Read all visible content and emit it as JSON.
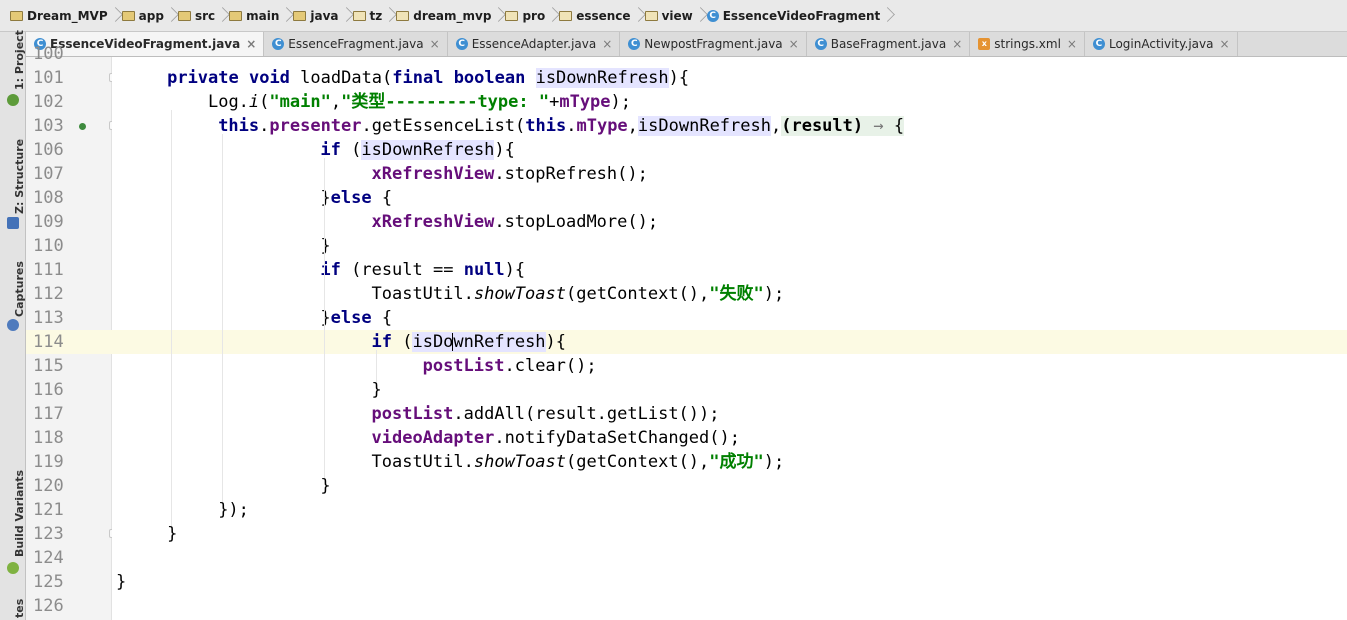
{
  "breadcrumb": {
    "items": [
      {
        "label": "Dream_MVP",
        "icon": "module-folder-icon"
      },
      {
        "label": "app",
        "icon": "module-folder-icon"
      },
      {
        "label": "src",
        "icon": "folder-icon"
      },
      {
        "label": "main",
        "icon": "folder-icon"
      },
      {
        "label": "java",
        "icon": "folder-icon"
      },
      {
        "label": "tz",
        "icon": "package-icon"
      },
      {
        "label": "dream_mvp",
        "icon": "package-icon"
      },
      {
        "label": "pro",
        "icon": "package-icon"
      },
      {
        "label": "essence",
        "icon": "package-icon"
      },
      {
        "label": "view",
        "icon": "package-icon"
      },
      {
        "label": "EssenceVideoFragment",
        "icon": "class-icon"
      }
    ]
  },
  "tabs": [
    {
      "label": "EssenceVideoFragment.java",
      "active": true,
      "close": "×"
    },
    {
      "label": "EssenceFragment.java",
      "close": "×"
    },
    {
      "label": "EssenceAdapter.java",
      "close": "×"
    },
    {
      "label": "NewpostFragment.java",
      "close": "×"
    },
    {
      "label": "BaseFragment.java",
      "close": "×"
    },
    {
      "label": "strings.xml",
      "close": "×"
    },
    {
      "label": "LoginActivity.java",
      "close": "×"
    }
  ],
  "tool_windows": {
    "project": "1: Project",
    "structure": "Z: Structure",
    "captures": "Captures",
    "build_variants": "Build Variants",
    "favorites": "tes"
  },
  "editor": {
    "line_numbers": [
      "100",
      "101",
      "102",
      "103",
      "106",
      "107",
      "108",
      "109",
      "110",
      "111",
      "112",
      "113",
      "114",
      "115",
      "116",
      "117",
      "118",
      "119",
      "120",
      "121",
      "123",
      "124",
      "125",
      "126"
    ],
    "current_line": "114",
    "lines": [
      [],
      [
        [
          "kw",
          "private void "
        ],
        [
          "",
          "loadData("
        ],
        [
          "kw",
          "final boolean "
        ],
        [
          "hlp",
          "isDownRefresh"
        ],
        [
          "",
          "){"
        ]
      ],
      [
        [
          "",
          "Log."
        ],
        [
          "ital",
          "i"
        ],
        [
          "",
          "("
        ],
        [
          "str",
          "\"main\""
        ],
        [
          "",
          ","
        ],
        [
          "str",
          "\"类型---------type: \""
        ],
        [
          "",
          "+"
        ],
        [
          "fld",
          "mType"
        ],
        [
          "",
          ");"
        ]
      ],
      [
        [
          "kw",
          "this"
        ],
        [
          "",
          "."
        ],
        [
          "fld",
          "presenter"
        ],
        [
          "",
          ".getEssenceList("
        ],
        [
          "kw",
          "this"
        ],
        [
          "",
          "."
        ],
        [
          "fld",
          "mType"
        ],
        [
          "",
          ","
        ],
        [
          "hlp",
          "isDownRefresh"
        ],
        [
          "",
          ","
        ],
        [
          "foldb",
          "(result) "
        ],
        [
          "foldarrow",
          "→ "
        ],
        [
          "fold",
          "{"
        ]
      ],
      [
        [
          "kw",
          "if "
        ],
        [
          "",
          "("
        ],
        [
          "hlp",
          "isDownRefresh"
        ],
        [
          "",
          "){"
        ]
      ],
      [
        [
          "fld",
          "xRefreshView"
        ],
        [
          "",
          ".stopRefresh();"
        ]
      ],
      [
        [
          "",
          "}"
        ],
        [
          "kw",
          "else "
        ],
        [
          "",
          "{"
        ]
      ],
      [
        [
          "fld",
          "xRefreshView"
        ],
        [
          "",
          ".stopLoadMore();"
        ]
      ],
      [
        [
          "",
          "}"
        ]
      ],
      [
        [
          "kw",
          "if "
        ],
        [
          "",
          "(result == "
        ],
        [
          "kw",
          "null"
        ],
        [
          "",
          "){"
        ]
      ],
      [
        [
          "",
          "ToastUtil."
        ],
        [
          "ital",
          "showToast"
        ],
        [
          "",
          "(getContext(),"
        ],
        [
          "str",
          "\"失败\""
        ],
        [
          "",
          ");"
        ]
      ],
      [
        [
          "",
          "}"
        ],
        [
          "kw",
          "else "
        ],
        [
          "",
          "{"
        ]
      ],
      [
        [
          "kw",
          "if "
        ],
        [
          "",
          "("
        ],
        [
          "hlp",
          "isDo"
        ],
        [
          "caret",
          ""
        ],
        [
          "hlp",
          "wnRefresh"
        ],
        [
          "",
          "){"
        ]
      ],
      [
        [
          "fld",
          "postList"
        ],
        [
          "",
          ".clear();"
        ]
      ],
      [
        [
          "",
          "}"
        ]
      ],
      [
        [
          "fld",
          "postList"
        ],
        [
          "",
          ".addAll(result.getList());"
        ]
      ],
      [
        [
          "fld",
          "videoAdapter"
        ],
        [
          "",
          ".notifyDataSetChanged();"
        ]
      ],
      [
        [
          "",
          "ToastUtil."
        ],
        [
          "ital",
          "showToast"
        ],
        [
          "",
          "(getContext(),"
        ],
        [
          "str",
          "\"成功\""
        ],
        [
          "",
          ");"
        ]
      ],
      [
        [
          "",
          "}"
        ]
      ],
      [
        [
          "",
          "});"
        ]
      ],
      [
        [
          "",
          "}"
        ]
      ],
      [],
      [
        [
          "",
          "}"
        ]
      ],
      []
    ]
  },
  "icons": {
    "class": "C",
    "xml": "x"
  }
}
